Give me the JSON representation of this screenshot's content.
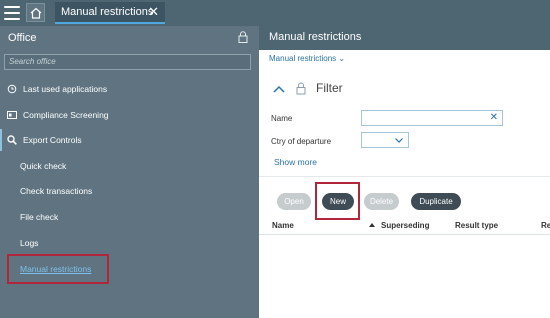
{
  "topbar": {
    "tab_label": "Manual restrictions",
    "tab_close": "✕"
  },
  "sidebar": {
    "title": "Office",
    "search_placeholder": "Search office",
    "items": [
      {
        "label": "Last used applications",
        "icon": "history-icon"
      },
      {
        "label": "Compliance Screening",
        "icon": "id-card-icon"
      },
      {
        "label": "Export Controls",
        "icon": "search-icon"
      }
    ],
    "sub_items": [
      {
        "label": "Quick check"
      },
      {
        "label": "Check transactions"
      },
      {
        "label": "File check"
      },
      {
        "label": "Logs"
      },
      {
        "label": "Manual restrictions"
      }
    ]
  },
  "main": {
    "title": "Manual restrictions",
    "breadcrumb": "Manual restrictions ⌄",
    "filter": {
      "title": "Filter",
      "name_label": "Name",
      "name_value": "",
      "clear_symbol": "✕",
      "country_label": "Ctry of departure",
      "country_value": "",
      "show_more": "Show more"
    },
    "actions": {
      "open": "Open",
      "new": "New",
      "delete": "Delete",
      "duplicate": "Duplicate"
    },
    "table": {
      "columns": [
        "Name",
        "Superseding",
        "Result type",
        "Re"
      ]
    }
  },
  "colors": {
    "highlight": "#b0263a",
    "accent": "#4fa9de",
    "header": "#4e6572"
  }
}
